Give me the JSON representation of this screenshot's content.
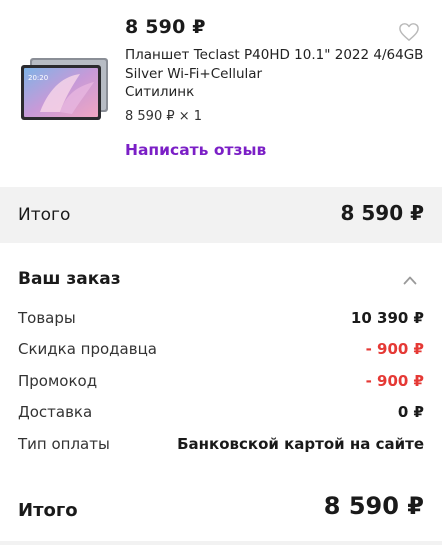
{
  "product": {
    "price": "8 590 ₽",
    "title": "Планшет Teclast P40HD 10.1\" 2022 4/64GB Silver Wi-Fi+Cellular",
    "seller": "Ситилинк",
    "quantity": "8 590 ₽ × 1",
    "review_label": "Написать отзыв",
    "image_icon": "tablet-image",
    "favorite_icon": "heart-outline-icon"
  },
  "total_band": {
    "label": "Итого",
    "value": "8 590 ₽"
  },
  "order": {
    "title": "Ваш заказ",
    "toggle_icon": "chevron-up-icon",
    "rows": [
      {
        "label": "Товары",
        "value": "10 390 ₽",
        "negative": false
      },
      {
        "label": "Скидка продавца",
        "value": "- 900 ₽",
        "negative": true
      },
      {
        "label": "Промокод",
        "value": "- 900 ₽",
        "negative": true
      },
      {
        "label": "Доставка",
        "value": "0 ₽",
        "negative": false
      },
      {
        "label": "Тип оплаты",
        "value": "Банковской картой на сайте",
        "negative": false
      }
    ]
  },
  "final_total": {
    "label": "Итого",
    "value": "8 590 ₽"
  },
  "colors": {
    "accent": "#7b1fc6",
    "negative": "#e53935",
    "band": "#f2f2f2"
  }
}
